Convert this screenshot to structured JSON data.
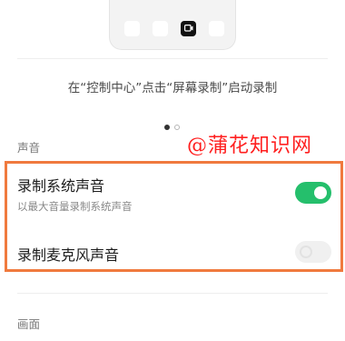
{
  "hint": "在“控制中心”点击“屏幕录制”启动录制",
  "pager": {
    "current": 1,
    "total": 2
  },
  "sound_section": {
    "label": "声音"
  },
  "watermark": "@蒲花知识网",
  "options": [
    {
      "title": "录制系统声音",
      "subtitle": "以最大音量录制系统声音",
      "enabled": true
    },
    {
      "title": "录制麦克风声音",
      "subtitle": "",
      "enabled": false
    }
  ],
  "picture_section": {
    "label": "画面"
  },
  "colors": {
    "toggle_on": "#25bf6c",
    "highlight": "#f07a3e",
    "watermark": "#ff1f1f"
  },
  "icons": {
    "screen_record": "screen-record-icon"
  }
}
